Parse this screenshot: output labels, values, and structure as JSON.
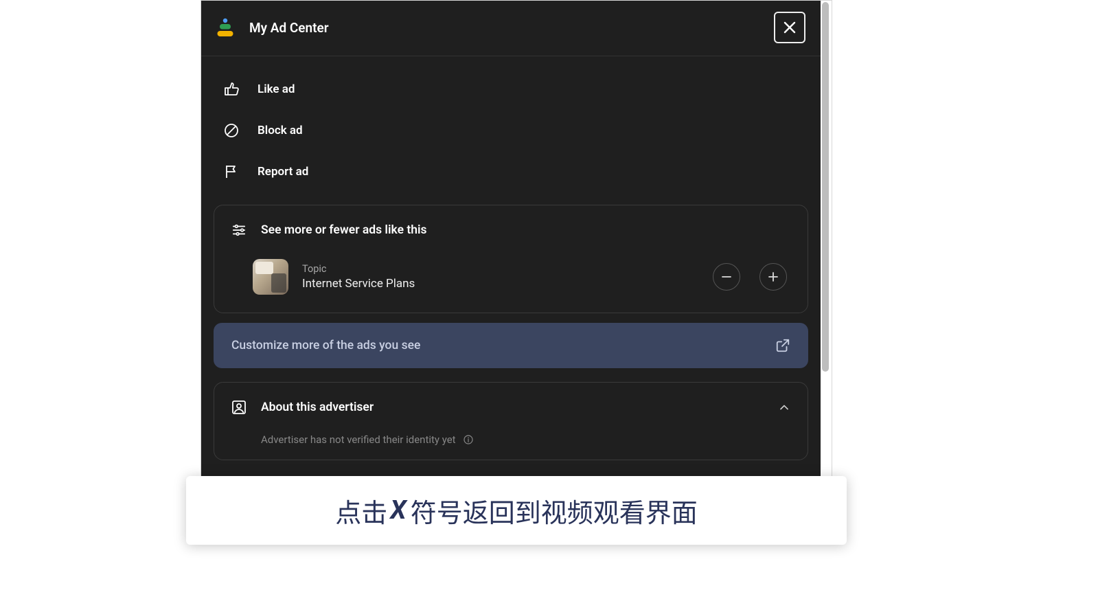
{
  "header": {
    "title": "My Ad Center"
  },
  "actions": {
    "like": "Like ad",
    "block": "Block ad",
    "report": "Report ad"
  },
  "adsCard": {
    "heading": "See more or fewer ads like this",
    "topicLabel": "Topic",
    "topicName": "Internet Service Plans"
  },
  "customize": {
    "label": "Customize more of the ads you see"
  },
  "about": {
    "heading": "About this advertiser",
    "sub": "Advertiser has not verified their identity yet"
  },
  "caption": {
    "prefix": "点击",
    "x": "X",
    "suffix": "符号返回到视频观看界面"
  }
}
